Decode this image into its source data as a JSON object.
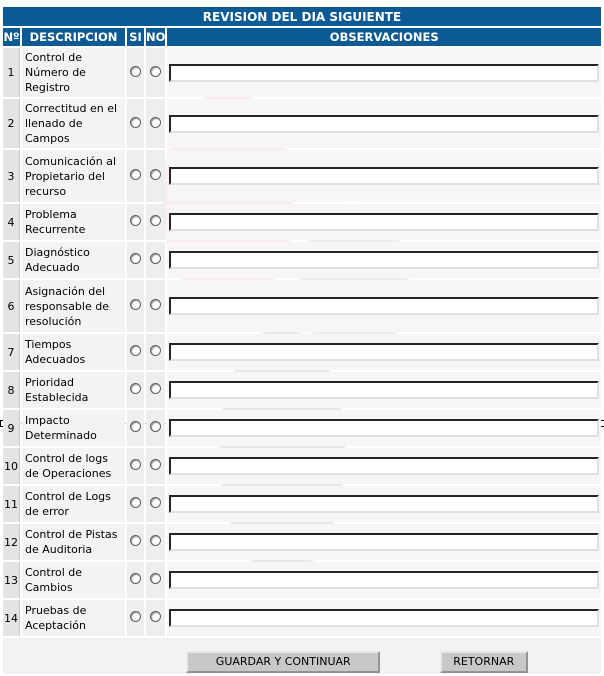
{
  "form": {
    "title": "REVISION DEL DIA SIGUIENTE",
    "columns": {
      "num": "Nº",
      "desc": "DESCRIPCION",
      "si": "SI",
      "no": "NO",
      "obs": "OBSERVACIONES"
    },
    "rows": [
      {
        "n": "1",
        "d": "Control de Número de Registro"
      },
      {
        "n": "2",
        "d": "Correctitud en el llenado de Campos"
      },
      {
        "n": "3",
        "d": "Comunicación al Propietario del recurso"
      },
      {
        "n": "4",
        "d": "Problema Recurrente"
      },
      {
        "n": "5",
        "d": "Diagnóstico Adecuado"
      },
      {
        "n": "6",
        "d": "Asignación del responsable de resolución"
      },
      {
        "n": "7",
        "d": "Tiempos Adecuados"
      },
      {
        "n": "8",
        "d": "Prioridad Establecida"
      },
      {
        "n": "9",
        "d": "Impacto Determinado"
      },
      {
        "n": "10",
        "d": "Control de logs de Operaciones"
      },
      {
        "n": "11",
        "d": "Control de Logs de error"
      },
      {
        "n": "12",
        "d": "Control de Pistas de Auditoria"
      },
      {
        "n": "13",
        "d": "Control de Cambios"
      },
      {
        "n": "14",
        "d": "Pruebas de Aceptación"
      }
    ],
    "buttons": {
      "save": "GUARDAR Y CONTINUAR",
      "back": "RETORNAR"
    }
  }
}
